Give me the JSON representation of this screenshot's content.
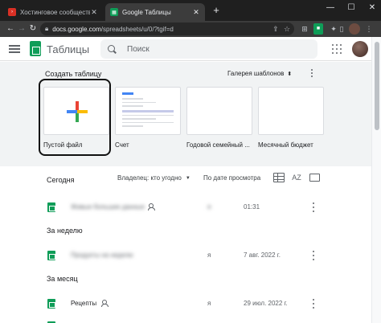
{
  "browser": {
    "tabs": [
      {
        "title": "Хостинговое сообщество «Тим...",
        "favicon": "hosting-favicon",
        "active": false
      },
      {
        "title": "Google Таблицы",
        "favicon": "sheets-favicon",
        "active": true
      }
    ],
    "new_tab": "+",
    "window_controls": {
      "minimize": "—",
      "maximize": "☐",
      "close": "✕"
    },
    "url_host": "docs.google.com",
    "url_path": "/spreadsheets/u/0/?tgif=d"
  },
  "app": {
    "title": "Таблицы",
    "search_placeholder": "Поиск"
  },
  "gallery": {
    "heading": "Создать таблицу",
    "templates_link": "Галерея шаблонов",
    "templates": [
      {
        "label": "Пустой файл",
        "thumb": "blank-plus"
      },
      {
        "label": "Счет",
        "thumb": "invoice"
      },
      {
        "label": "Годовой семейный ...",
        "thumb": "empty"
      },
      {
        "label": "Месячный бюджет",
        "thumb": "empty"
      }
    ]
  },
  "list": {
    "owner_filter": "Владелец: кто угодно",
    "sort_by": "По дате просмотра",
    "sort_icon": "AZ",
    "sections": {
      "today": "Сегодня",
      "week": "За неделю",
      "month": "За месяц"
    },
    "rows": [
      {
        "name": "Живые большие данные",
        "owner": "я",
        "date": "01:31",
        "shared": true,
        "blurred": true
      },
      {
        "name": "Продукты на неделю",
        "owner": "я",
        "date": "7 авг. 2022 г.",
        "shared": false,
        "blurred": true
      },
      {
        "name": "Рецепты",
        "owner": "я",
        "date": "29 июл. 2022 г.",
        "shared": true,
        "blurred": false
      }
    ]
  },
  "colors": {
    "sheets_green": "#0f9d58",
    "chrome_dark": "#1f1f1f",
    "gallery_bg": "#f1f3f4"
  }
}
